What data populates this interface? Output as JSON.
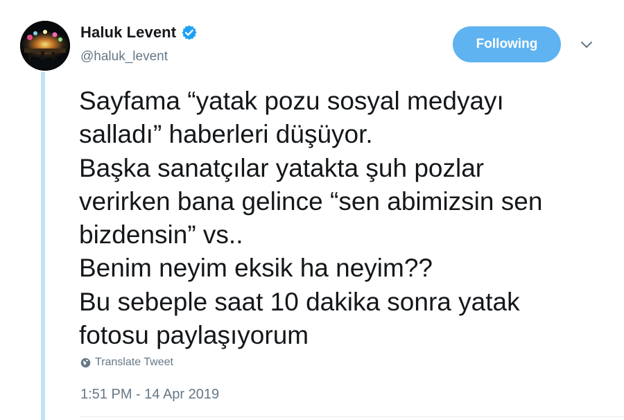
{
  "user": {
    "display_name": "Haluk Levent",
    "handle": "@haluk_levent",
    "verified": true
  },
  "follow_button": {
    "label": "Following"
  },
  "tweet": {
    "lines": [
      "Sayfama “yatak pozu sosyal medyayı",
      "salladı” haberleri düşüyor.",
      "Başka sanatçılar yatakta şuh pozlar",
      "verirken bana gelince “sen abimizsin sen",
      "bizdensin” vs..",
      "Benim neyim eksik ha neyim??",
      "Bu sebeple saat 10 dakika sonra yatak",
      "fotosu paylaşıyorum"
    ]
  },
  "translate": {
    "label": "Translate Tweet"
  },
  "timestamp": "1:51 PM - 14 Apr 2019",
  "icons": {
    "verified": "verified-badge-icon",
    "menu": "chevron-down-icon",
    "translate": "globe-icon"
  },
  "colors": {
    "accent": "#5fb3f0",
    "verified": "#1da1f2",
    "muted": "#657786",
    "text": "#14171a",
    "thread_line": "#c4e2f7"
  }
}
